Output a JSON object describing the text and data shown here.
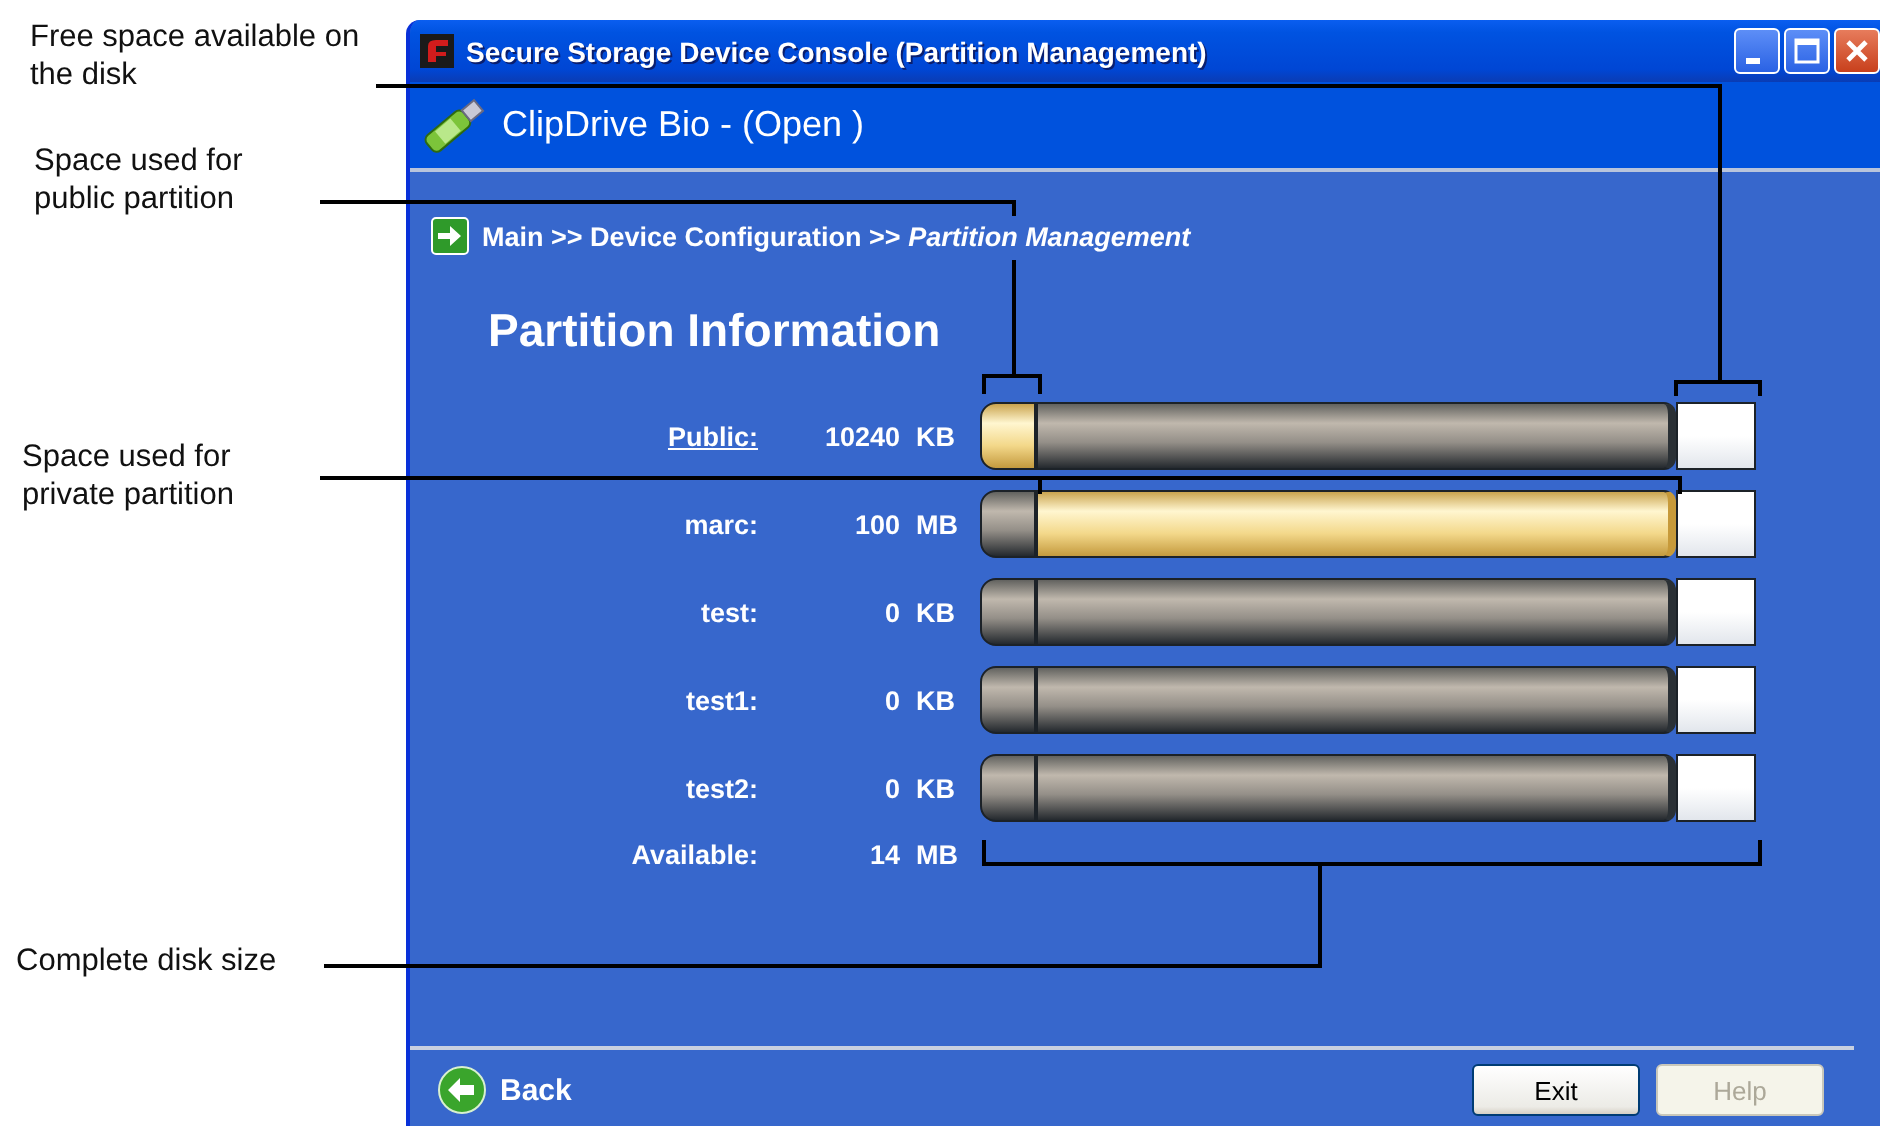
{
  "callouts": [
    {
      "text": "Free space available on the disk"
    },
    {
      "text": "Space used for public partition"
    },
    {
      "text": "Space used for private partition"
    },
    {
      "text": "Complete disk size"
    }
  ],
  "window": {
    "title": "Secure Storage Device Console (Partition Management)"
  },
  "header": {
    "device": "ClipDrive Bio - (Open )"
  },
  "breadcrumb": "Main >> Device Configuration >> *Partition Management*",
  "heading": "Partition Information",
  "partitions": [
    {
      "name": "Public:",
      "link": true,
      "amount": "10240",
      "unit": "KB",
      "segments": [
        {
          "selected": true
        },
        {
          "selected": false
        }
      ]
    },
    {
      "name": "marc:",
      "link": false,
      "amount": "100",
      "unit": "MB",
      "segments": [
        {
          "selected": false
        },
        {
          "selected": true
        }
      ]
    },
    {
      "name": "test:",
      "link": false,
      "amount": "0",
      "unit": "KB",
      "segments": [
        {
          "selected": false
        },
        {
          "selected": false
        }
      ]
    },
    {
      "name": "test1:",
      "link": false,
      "amount": "0",
      "unit": "KB",
      "segments": [
        {
          "selected": false
        },
        {
          "selected": false
        }
      ]
    },
    {
      "name": "test2:",
      "link": false,
      "amount": "0",
      "unit": "KB",
      "segments": [
        {
          "selected": false
        },
        {
          "selected": false
        }
      ]
    }
  ],
  "available": {
    "label": "Available:",
    "amount": "14",
    "unit": "MB"
  },
  "footer": {
    "back": "Back",
    "buttons": [
      {
        "label": "Exit",
        "disabled": false
      },
      {
        "label": "Help",
        "disabled": true
      }
    ]
  }
}
